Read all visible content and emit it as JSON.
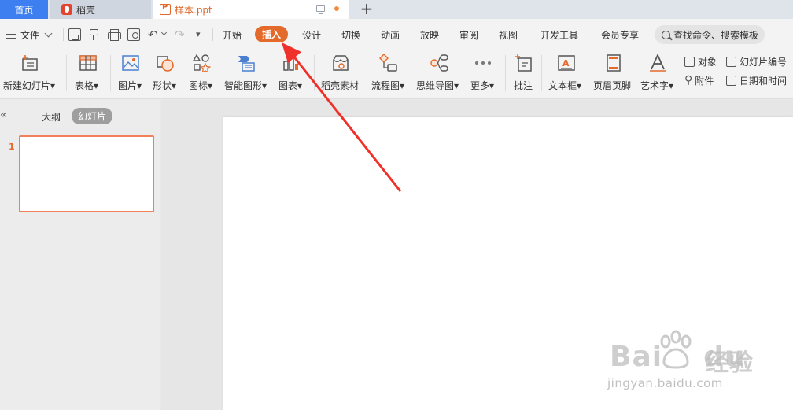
{
  "tabs": [
    {
      "label": "首页",
      "active": false
    },
    {
      "label": "稻壳",
      "icon": "daoke-icon"
    },
    {
      "label": "样本.ppt",
      "icon": "ppt-file-icon",
      "active": true
    }
  ],
  "quick_access": {
    "file_label": "文件",
    "icons": [
      "save-icon",
      "format-painter-icon",
      "print-icon",
      "print-preview-icon",
      "undo-icon",
      "redo-icon",
      "more-icon"
    ]
  },
  "menu": {
    "items": [
      "开始",
      "插入",
      "设计",
      "切换",
      "动画",
      "放映",
      "审阅",
      "视图",
      "开发工具",
      "会员专享"
    ],
    "active": "插入"
  },
  "search": {
    "label": "查找命令、搜索模板"
  },
  "ribbon": {
    "buttons": [
      {
        "label": "新建幻灯片",
        "dropdown": true
      },
      {
        "label": "表格",
        "dropdown": true
      },
      {
        "label": "图片",
        "dropdown": true
      },
      {
        "label": "形状",
        "dropdown": true
      },
      {
        "label": "图标",
        "dropdown": true
      },
      {
        "label": "智能图形",
        "dropdown": true
      },
      {
        "label": "图表",
        "dropdown": true
      },
      {
        "label": "稻壳素材",
        "dropdown": false
      },
      {
        "label": "流程图",
        "dropdown": true
      },
      {
        "label": "思维导图",
        "dropdown": true
      },
      {
        "label": "更多",
        "dropdown": true
      },
      {
        "label": "批注",
        "dropdown": false
      },
      {
        "label": "文本框",
        "dropdown": true
      },
      {
        "label": "页眉页脚",
        "dropdown": false
      },
      {
        "label": "艺术字",
        "dropdown": true
      }
    ],
    "small_buttons": [
      {
        "label": "对象"
      },
      {
        "label": "附件"
      },
      {
        "label": "幻灯片编号"
      },
      {
        "label": "日期和时间"
      }
    ],
    "dropdown_glyph": "▾"
  },
  "side_panel": {
    "collapse_glyph": "«",
    "tab_outline": "大纲",
    "tab_slides": "幻灯片",
    "slides": [
      {
        "number": "1"
      }
    ]
  },
  "watermark": {
    "brand": "Bai",
    "brand2": "du",
    "cn": "经验",
    "url": "jingyan.baidu.com"
  },
  "colors": {
    "accent": "#e36a2a",
    "home_tab": "#3d7ef0",
    "arrow": "#f0302a",
    "thumb_border": "#f0805c"
  }
}
